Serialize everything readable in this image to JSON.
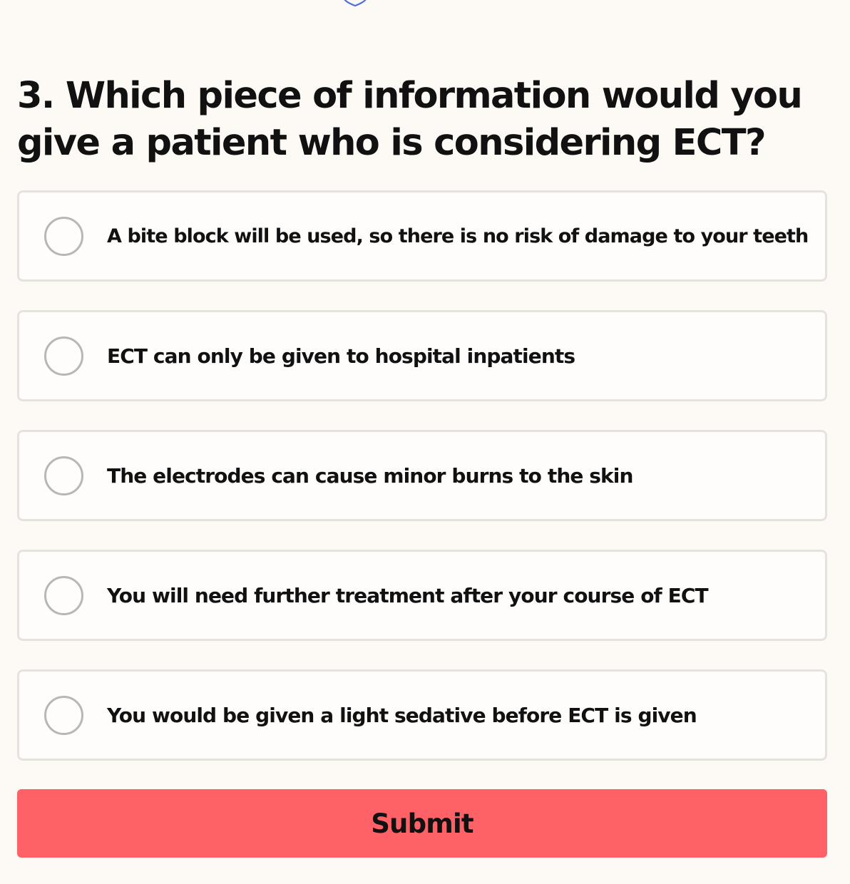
{
  "header": {
    "icon": "shield-icon",
    "icon_color": "#4f6fd6"
  },
  "question": {
    "text": "3. Which piece of information would you give a patient who is considering ECT?"
  },
  "options": [
    {
      "label": "A bite block will be used, so there is no risk of damage to your teeth",
      "selected": false
    },
    {
      "label": "ECT can only be given to hospital inpatients",
      "selected": false
    },
    {
      "label": "The electrodes can cause minor burns to the skin",
      "selected": false
    },
    {
      "label": "You will need further treatment after your course of ECT",
      "selected": false
    },
    {
      "label": "You would be given a light sedative before ECT is given",
      "selected": false
    }
  ],
  "submit": {
    "label": "Submit",
    "color": "#ff6266"
  },
  "colors": {
    "background": "#fdf9f5",
    "option_border": "#e6e3df",
    "radio_border": "#b9b6b3",
    "text": "#111111"
  }
}
